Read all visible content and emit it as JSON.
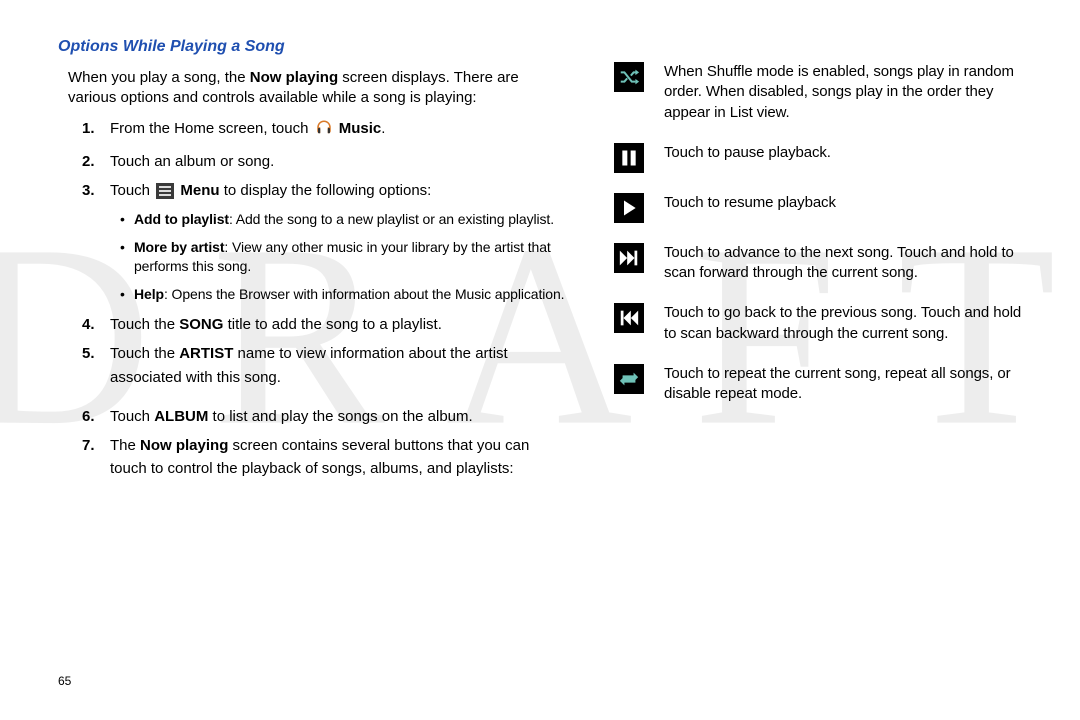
{
  "watermark": "DRAFT",
  "page_number": "65",
  "heading": "Options While Playing a Song",
  "intro_1": "When you play a song, the ",
  "intro_bold": "Now playing",
  "intro_2": " screen displays. There are various options and controls available while a song is playing:",
  "step1_a": "From the Home screen, touch ",
  "step1_b": "Music",
  "step1_c": ".",
  "step2": "Touch an album or song.",
  "step3_a": "Touch ",
  "step3_b": "Menu",
  "step3_c": " to display the following options:",
  "bullet1_label": "Add to playlist",
  "bullet1_rest": ": Add the song to a new playlist or an existing playlist.",
  "bullet2_label": "More by artist",
  "bullet2_rest": ": View any other music in your library by the artist that performs this song.",
  "bullet3_label": "Help",
  "bullet3_rest": ": Opens the Browser with information about the Music application.",
  "step4_a": "Touch the ",
  "step4_b": "SONG",
  "step4_c": " title to add the song to a playlist.",
  "step5_a": "Touch the ",
  "step5_b": "ARTIST",
  "step5_c": " name to view information about the artist associated with this song.",
  "step6_a": "Touch ",
  "step6_b": "ALBUM",
  "step6_c": " to list and play the songs on the album.",
  "step7_a": "The ",
  "step7_b": "Now playing",
  "step7_c": " screen contains several buttons that you can touch to control the playback of songs, albums, and playlists:",
  "icons": {
    "shuffle": "When Shuffle mode is enabled, songs play in random order. When disabled, songs play in the order they appear in List view.",
    "pause": "Touch to pause playback.",
    "play": "Touch to resume playback",
    "next": "Touch to advance to the next song. Touch and hold to scan forward through the current song.",
    "prev": "Touch to go back to the previous song. Touch and hold to scan backward through the current song.",
    "repeat": "Touch to repeat the current song, repeat all songs, or disable repeat mode."
  }
}
